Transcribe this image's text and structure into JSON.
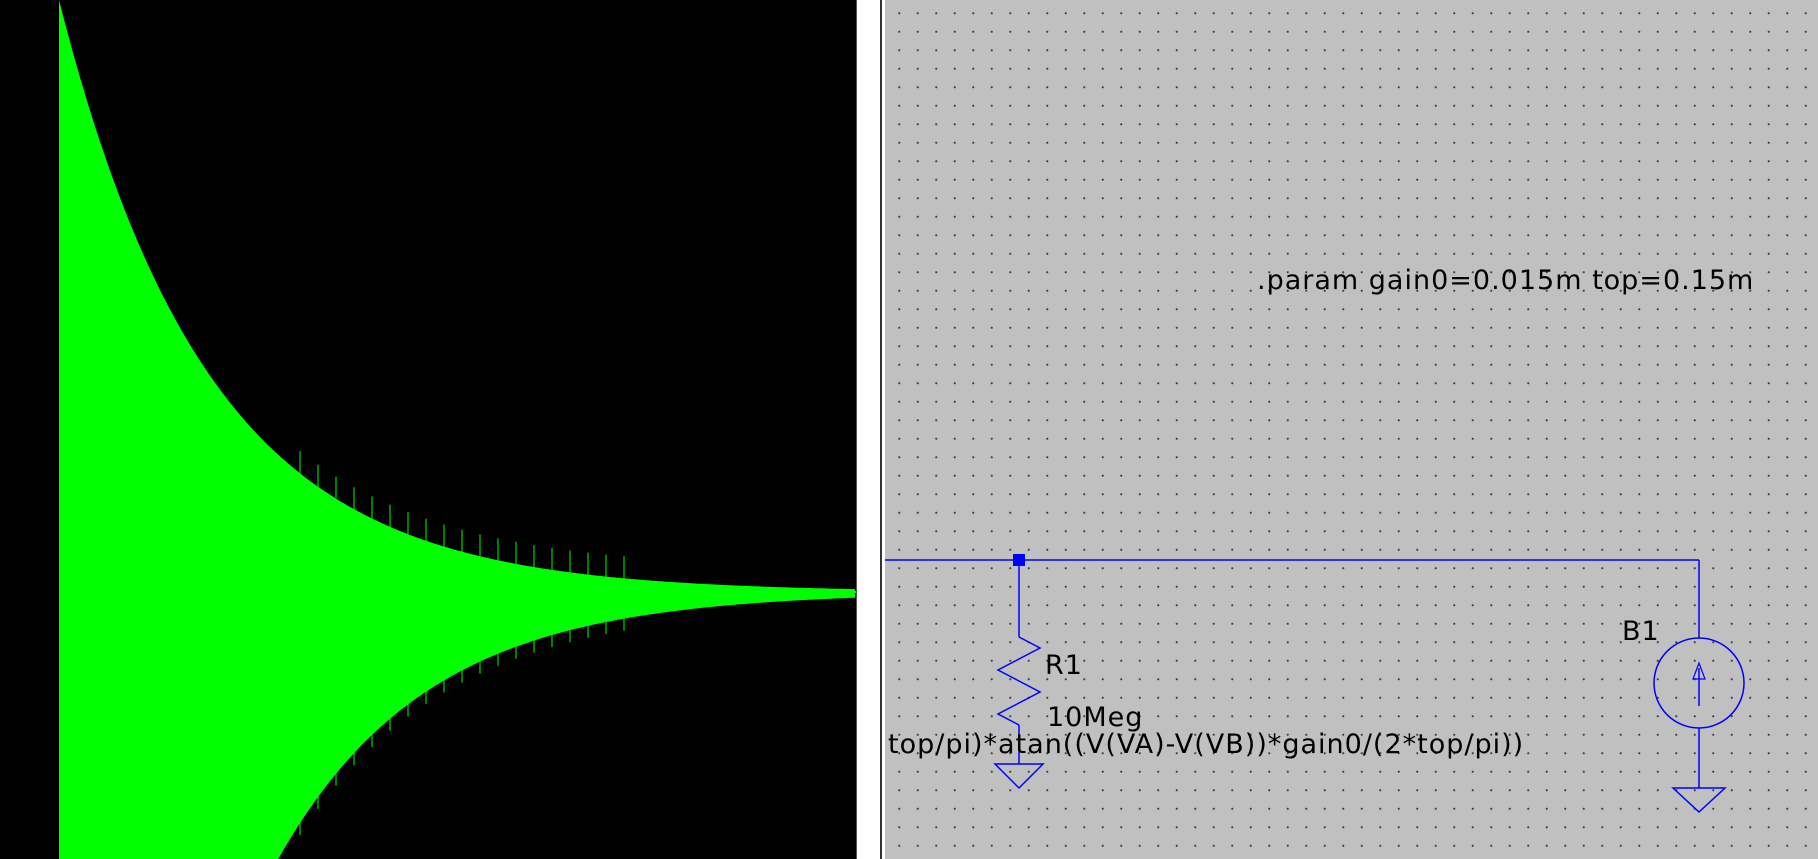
{
  "waveform": {
    "trace_color": "#00ff00",
    "background_color": "#000000"
  },
  "schematic": {
    "param_directive": ".param gain0=0.015m top=0.15m",
    "wire_color": "#0000ff",
    "components": {
      "resistor": {
        "name": "R1",
        "value": "10Meg"
      },
      "source": {
        "name": "B1",
        "expression": "top/pi)*atan((V(VA)-V(VB))*gain0/(2*top/pi))"
      }
    }
  }
}
